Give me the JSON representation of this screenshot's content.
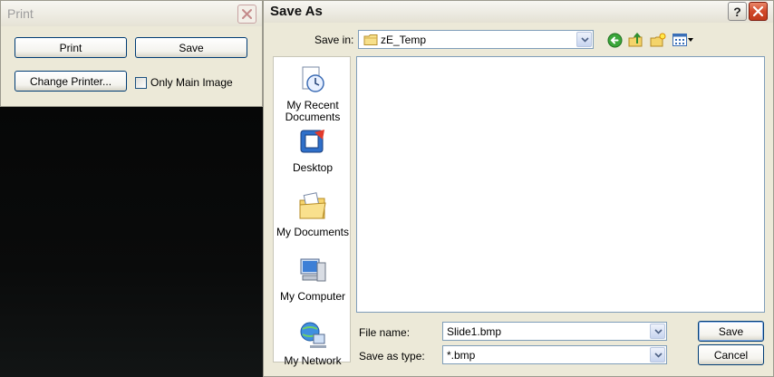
{
  "print_dialog": {
    "title": "Print",
    "buttons": {
      "print": "Print",
      "save": "Save",
      "change_printer": "Change Printer..."
    },
    "only_main_image_label": "Only Main Image",
    "only_main_image_checked": false
  },
  "save_dialog": {
    "title": "Save As",
    "help_label": "?",
    "save_in_label": "Save in:",
    "save_in_value": "zE_Temp",
    "toolbar_icons": [
      "back-icon",
      "up-folder-icon",
      "new-folder-icon",
      "views-menu-icon"
    ],
    "places": [
      {
        "label_line1": "My Recent",
        "label_line2": "Documents",
        "icon": "recent-documents-icon"
      },
      {
        "label_line1": "Desktop",
        "label_line2": "",
        "icon": "desktop-icon"
      },
      {
        "label_line1": "My Documents",
        "label_line2": "",
        "icon": "my-documents-icon"
      },
      {
        "label_line1": "My Computer",
        "label_line2": "",
        "icon": "my-computer-icon"
      },
      {
        "label_line1": "My Network",
        "label_line2": "",
        "icon": "my-network-icon"
      }
    ],
    "file_name_label": "File name:",
    "file_name_value": "Slide1.bmp",
    "save_as_type_label": "Save as type:",
    "save_as_type_value": "*.bmp",
    "save_button": "Save",
    "cancel_button": "Cancel"
  },
  "colors": {
    "dialog_face": "#ece9d8",
    "button_border": "#003c74",
    "field_border": "#7f9db9",
    "close_red": "#d1492a",
    "background": "#050606"
  }
}
